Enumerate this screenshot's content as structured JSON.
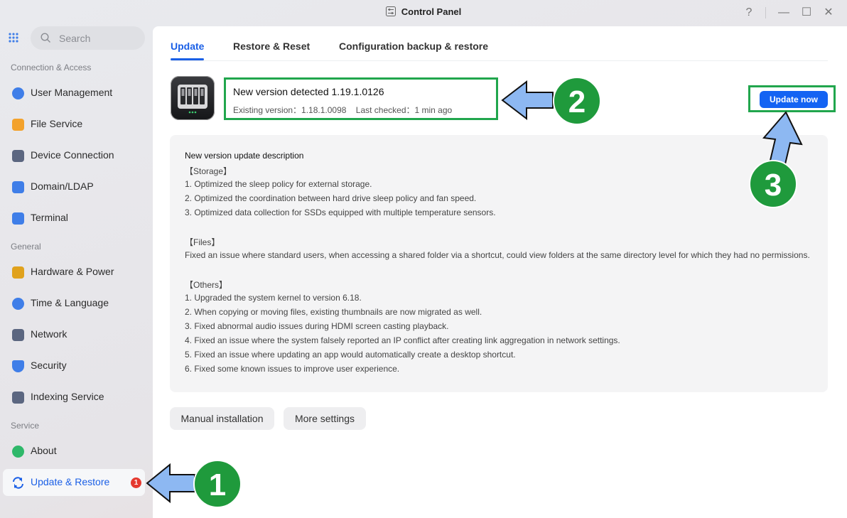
{
  "window": {
    "title": "Control Panel",
    "help": "?",
    "minimize": "—",
    "maximize": "☐",
    "close": "✕"
  },
  "sidebar": {
    "search_placeholder": "Search",
    "sections": [
      "Connection & Access",
      "General",
      "Service"
    ],
    "items": [
      {
        "label": "User Management",
        "icon": "users-icon",
        "color": "#3f7ee8"
      },
      {
        "label": "File Service",
        "icon": "folder-icon",
        "color": "#f3a22c"
      },
      {
        "label": "Device Connection",
        "icon": "device-icon",
        "color": "#5b6680"
      },
      {
        "label": "Domain/LDAP",
        "icon": "domain-icon",
        "color": "#3f7ee8"
      },
      {
        "label": "Terminal",
        "icon": "terminal-icon",
        "color": "#3f7ee8"
      },
      {
        "label": "Hardware & Power",
        "icon": "hardware-icon",
        "color": "#e0a21d"
      },
      {
        "label": "Time & Language",
        "icon": "globe-icon",
        "color": "#3f7ee8"
      },
      {
        "label": "Network",
        "icon": "network-icon",
        "color": "#5b6680"
      },
      {
        "label": "Security",
        "icon": "shield-icon",
        "color": "#3f7ee8"
      },
      {
        "label": "Indexing Service",
        "icon": "indexing-icon",
        "color": "#5b6680"
      },
      {
        "label": "About",
        "icon": "info-icon",
        "color": "#2fb86a"
      },
      {
        "label": "Update & Restore",
        "icon": "sync-icon",
        "color": "#1a5fe6",
        "badge": "1"
      }
    ]
  },
  "tabs": [
    "Update",
    "Restore & Reset",
    "Configuration backup & restore"
  ],
  "update": {
    "title": "New version detected 1.19.1.0126",
    "existing": "Existing version：1.18.1.0098",
    "checked": "Last checked：1 min ago",
    "button": "Update now"
  },
  "description": {
    "heading": "New version update description",
    "lines": [
      "【Storage】",
      "1. Optimized the sleep policy for external storage.",
      "2. Optimized the coordination between hard drive sleep policy and fan speed.",
      "3. Optimized data collection for SSDs equipped with multiple temperature sensors.",
      "",
      "【Files】",
      "Fixed an issue where standard users, when accessing a shared folder via a shortcut, could view folders at the same directory level for which they had no permissions.",
      "",
      "【Others】",
      "1. Upgraded the system kernel to version 6.18.",
      "2. When copying or moving files, existing thumbnails are now migrated as well.",
      "3. Fixed abnormal audio issues during HDMI screen casting playback.",
      "4. Fixed an issue where the system falsely reported an IP conflict after creating link aggregation in network settings.",
      "5. Fixed an issue where updating an app would automatically create a desktop shortcut.",
      "6. Fixed some known issues to improve user experience."
    ]
  },
  "buttons": {
    "manual": "Manual installation",
    "more": "More settings"
  },
  "annotations": [
    "1",
    "2",
    "3"
  ],
  "colors": {
    "accent": "#1a5fe6",
    "highlight": "#21a64d",
    "callout": "#1f9a3c",
    "arrow": "#8db8f2"
  }
}
